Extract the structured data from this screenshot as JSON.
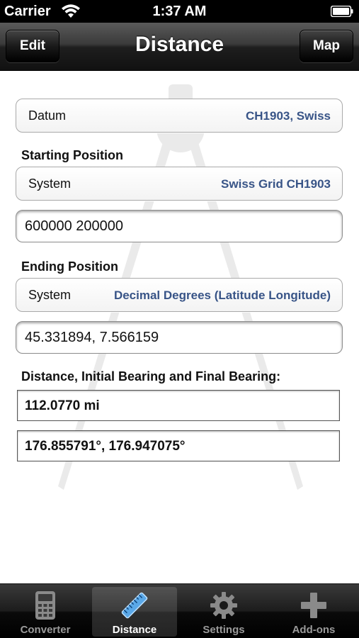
{
  "status_bar": {
    "carrier": "Carrier",
    "time": "1:37 AM"
  },
  "nav": {
    "title": "Distance",
    "left_button": "Edit",
    "right_button": "Map"
  },
  "datum": {
    "label": "Datum",
    "value": "CH1903, Swiss"
  },
  "starting_position": {
    "header": "Starting Position",
    "system_label": "System",
    "system_value": "Swiss Grid CH1903",
    "coordinates": "600000 200000"
  },
  "ending_position": {
    "header": "Ending Position",
    "system_label": "System",
    "system_value": "Decimal Degrees (Latitude Longitude)",
    "coordinates": "45.331894, 7.566159"
  },
  "results": {
    "header": "Distance, Initial Bearing and Final Bearing:",
    "distance": "112.0770 mi",
    "bearings": "176.855791°,  176.947075°"
  },
  "tabs": [
    {
      "label": "Converter",
      "icon": "calculator-icon",
      "selected": false
    },
    {
      "label": "Distance",
      "icon": "ruler-icon",
      "selected": true
    },
    {
      "label": "Settings",
      "icon": "gear-icon",
      "selected": false
    },
    {
      "label": "Add-ons",
      "icon": "plus-icon",
      "selected": false
    }
  ],
  "colors": {
    "value_blue": "#385487",
    "status_bar": "#000000",
    "tab_selected_label": "#ffffff",
    "tab_label": "#9a9a9a"
  }
}
